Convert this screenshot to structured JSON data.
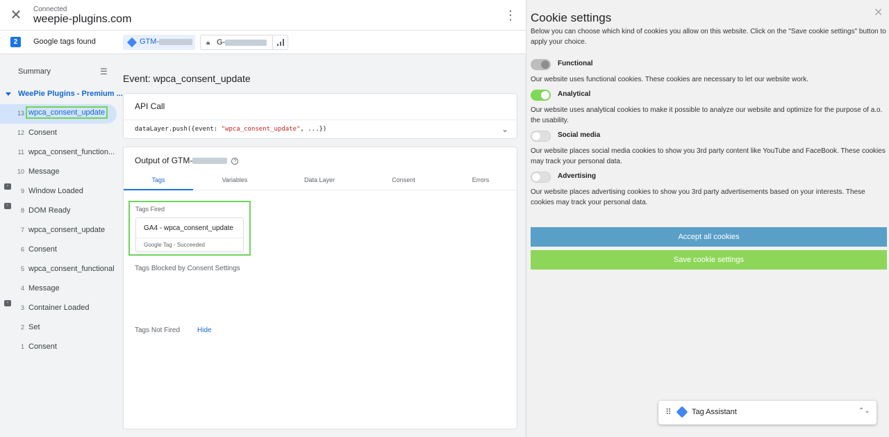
{
  "topbar": {
    "connected_label": "Connected",
    "domain": "weepie-plugins.com",
    "close_icon": "close-icon",
    "menu_icon": "kebab-menu-icon"
  },
  "tagbar": {
    "count": "2",
    "found_label": "Google tags found",
    "gtm_prefix": "GTM-",
    "ga_prefix": "G-"
  },
  "sidebar": {
    "summary": "Summary",
    "container": "WeePie Plugins - Premium ...",
    "events": [
      {
        "num": "13",
        "label": "wpca_consent_update",
        "icon": false
      },
      {
        "num": "12",
        "label": "Consent",
        "icon": false
      },
      {
        "num": "11",
        "label": "wpca_consent_function...",
        "icon": false
      },
      {
        "num": "10",
        "label": "Message",
        "icon": false
      },
      {
        "num": "9",
        "label": "Window Loaded",
        "icon": true
      },
      {
        "num": "8",
        "label": "DOM Ready",
        "icon": true
      },
      {
        "num": "7",
        "label": "wpca_consent_update",
        "icon": false
      },
      {
        "num": "6",
        "label": "Consent",
        "icon": false
      },
      {
        "num": "5",
        "label": "wpca_consent_functional",
        "icon": false
      },
      {
        "num": "4",
        "label": "Message",
        "icon": false
      },
      {
        "num": "3",
        "label": "Container Loaded",
        "icon": true
      },
      {
        "num": "2",
        "label": "Set",
        "icon": false
      },
      {
        "num": "1",
        "label": "Consent",
        "icon": false
      }
    ]
  },
  "main": {
    "event_title": "Event: wpca_consent_update",
    "api_card": {
      "header": "API Call",
      "code_prefix": "dataLayer.push({event: ",
      "code_string": "\"wpca_consent_update\"",
      "code_suffix": ", ...})"
    },
    "output_card": {
      "header_prefix": "Output of GTM-",
      "tabs": [
        "Tags",
        "Variables",
        "Data Layer",
        "Consent",
        "Errors"
      ],
      "tags_fired": "Tags Fired",
      "tag_name": "GA4 - wpca_consent_update",
      "tag_status": "Google Tag - Succeeded",
      "blocked_label": "Tags Blocked by Consent Settings",
      "not_fired_label": "Tags Not Fired",
      "hide_link": "Hide"
    }
  },
  "cookie": {
    "title": "Cookie settings",
    "close": "✕",
    "intro": "Below you can choose which kind of cookies you allow on this website. Click on the \"Save cookie settings\" button to apply your choice.",
    "categories": [
      {
        "name": "Functional",
        "state": "disabled",
        "desc": "Our website uses functional cookies. These cookies are necessary to let our website work."
      },
      {
        "name": "Analytical",
        "state": "on",
        "desc": "Our website uses analytical cookies to make it possible to analyze our website and optimize for the purpose of a.o. the usability."
      },
      {
        "name": "Social media",
        "state": "off",
        "desc": "Our website places social media cookies to show you 3rd party content like YouTube and FaceBook. These cookies may track your personal data."
      },
      {
        "name": "Advertising",
        "state": "off",
        "desc": "Our website places advertising cookies to show you 3rd party advertisements based on your interests. These cookies may track your personal data."
      }
    ],
    "accept_label": "Accept all cookies",
    "save_label": "Save cookie settings",
    "colors": {
      "accept": "#5a9fc8",
      "save": "#8ed65a",
      "toggle_on": "#7ed957"
    }
  },
  "widget": {
    "title": "Tag Assistant"
  }
}
